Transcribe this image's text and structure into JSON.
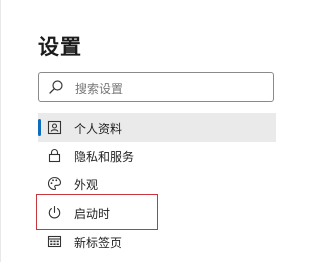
{
  "settings": {
    "title": "设置"
  },
  "search": {
    "placeholder": "搜索设置",
    "icon": "search-icon"
  },
  "nav": {
    "items": [
      {
        "label": "个人资料",
        "icon": "profile-icon",
        "selected": true
      },
      {
        "label": "隐私和服务",
        "icon": "lock-icon",
        "selected": false
      },
      {
        "label": "外观",
        "icon": "palette-icon",
        "selected": false
      },
      {
        "label": "启动时",
        "icon": "power-icon",
        "selected": false,
        "highlighted": true
      },
      {
        "label": "新标签页",
        "icon": "new-tab-icon",
        "selected": false
      }
    ]
  },
  "colors": {
    "accent": "#0f6cbd",
    "selected_bg": "#eaeaea",
    "highlight_border": "#c9373e"
  }
}
